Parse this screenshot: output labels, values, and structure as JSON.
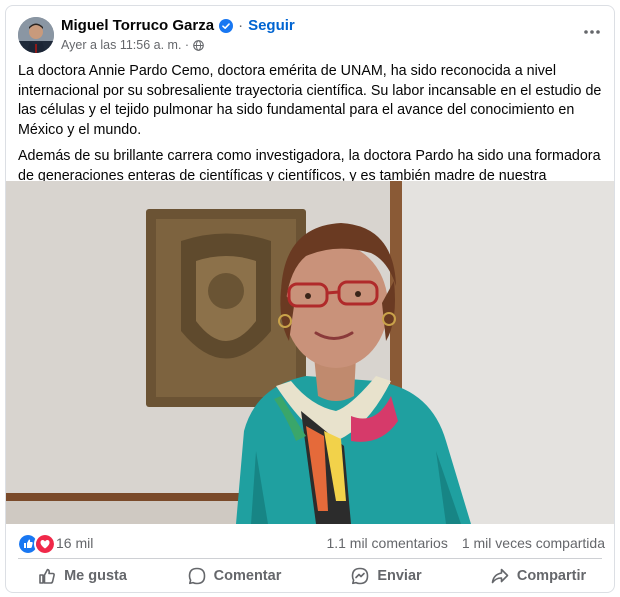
{
  "post": {
    "author": "Miguel Torruco Garza",
    "follow_label": "Seguir",
    "timestamp": "Ayer a las 11:56 a. m.",
    "paragraphs": [
      "La doctora Annie Pardo Cemo, doctora emérita de UNAM, ha sido reconocida a nivel internacional por su sobresaliente trayectoria científica. Su labor incansable en el estudio de las células y el tejido pulmonar ha sido fundamental para el avance del conocimiento en México y el mundo.",
      "Además de su brillante carrera como investigadora, la doctora Pardo ha sido una formadora de generaciones enteras de científicas y científicos, y es también madre de nuestra Presidenta Claudia Sheinbaum Pardo."
    ]
  },
  "stats": {
    "reactions": "16 mil",
    "comments": "1.1 mil comentarios",
    "shares": "1 mil veces compartida"
  },
  "actions": {
    "like": "Me gusta",
    "comment": "Comentar",
    "send": "Enviar",
    "share": "Compartir"
  },
  "colors": {
    "brand_blue": "#0064d1",
    "like_blue": "#1877f2",
    "love_red": "#f02849",
    "secondary_text": "#65676b"
  },
  "icons": [
    "verified-icon",
    "globe-icon",
    "more-icon",
    "like-reaction-icon",
    "love-reaction-icon",
    "like-icon",
    "comment-icon",
    "send-icon",
    "share-icon"
  ]
}
